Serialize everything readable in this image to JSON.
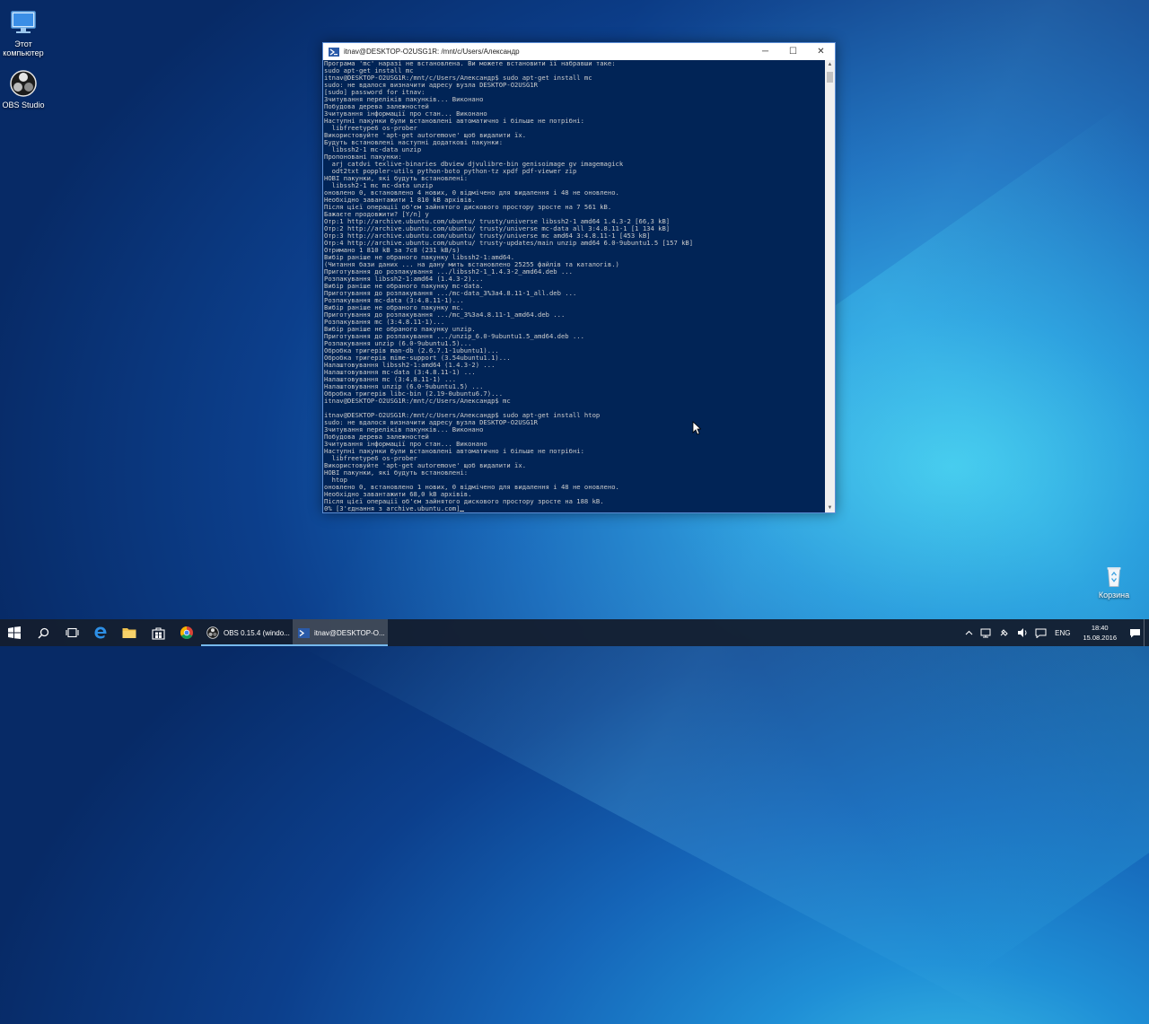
{
  "desktop": {
    "icons": [
      {
        "label": "Этот компьютер",
        "icon": "this-pc-icon"
      },
      {
        "label": "OBS Studio",
        "icon": "obs-icon"
      },
      {
        "label": "Корзина",
        "icon": "recycle-bin-icon"
      }
    ]
  },
  "window": {
    "title": "itnav@DESKTOP-O2USG1R: /mnt/c/Users/Александр",
    "minimize": "─",
    "maximize": "☐",
    "close": "✕",
    "console_lines": [
      "Програма 'mc' наразі не встановлена. Ви можете встановити її набравши таке:",
      "sudo apt-get install mc",
      "itnav@DESKTOP-O2USG1R:/mnt/c/Users/Александр$ sudo apt-get install mc",
      "sudo: не вдалося визначити адресу вузла DESKTOP-O2USG1R",
      "[sudo] password for itnav:",
      "Зчитування переліків пакунків... Виконано",
      "Побудова дерева залежностей",
      "Зчитування інформації про стан... Виконано",
      "Наступні пакунки були встановлені автоматично і більше не потрібні:",
      "  libfreetype6 os-prober",
      "Використовуйте 'apt-get autoremove' щоб видалити їх.",
      "Будуть встановлені наступні додаткові пакунки:",
      "  libssh2-1 mc-data unzip",
      "Пропоновані пакунки:",
      "  arj catdvi texlive-binaries dbview djvulibre-bin genisoimage gv imagemagick",
      "  odt2txt poppler-utils python-boto python-tz xpdf pdf-viewer zip",
      "НОВІ пакунки, які будуть встановлені:",
      "  libssh2-1 mc mc-data unzip",
      "оновлено 0, встановлено 4 нових, 0 відмічено для видалення і 48 не оновлено.",
      "Необхідно завантажити 1 810 kB архівів.",
      "Після цієї операції об'єм зайнятого дискового простору зросте на 7 561 kB.",
      "Бажаєте продовжити? [Y/n] y",
      "Отр:1 http://archive.ubuntu.com/ubuntu/ trusty/universe libssh2-1 amd64 1.4.3-2 [66,3 kB]",
      "Отр:2 http://archive.ubuntu.com/ubuntu/ trusty/universe mc-data all 3:4.8.11-1 [1 134 kB]",
      "Отр:3 http://archive.ubuntu.com/ubuntu/ trusty/universe mc amd64 3:4.8.11-1 [453 kB]",
      "Отр:4 http://archive.ubuntu.com/ubuntu/ trusty-updates/main unzip amd64 6.0-9ubuntu1.5 [157 kB]",
      "Отримано 1 810 kB за 7с8 (231 kB/s)",
      "Вибір раніше не обраного пакунку libssh2-1:amd64.",
      "(Читання бази даних ... на дану мить встановлено 25255 файлів та каталогів.)",
      "Приготування до розпакування .../libssh2-1_1.4.3-2_amd64.deb ...",
      "Розпакування libssh2-1:amd64 (1.4.3-2)...",
      "Вибір раніше не обраного пакунку mc-data.",
      "Приготування до розпакування .../mc-data_3%3a4.8.11-1_all.deb ...",
      "Розпакування mc-data (3:4.8.11-1)...",
      "Вибір раніше не обраного пакунку mc.",
      "Приготування до розпакування .../mc_3%3a4.8.11-1_amd64.deb ...",
      "Розпакування mc (3:4.8.11-1)...",
      "Вибір раніше не обраного пакунку unzip.",
      "Приготування до розпакування .../unzip_6.0-9ubuntu1.5_amd64.deb ...",
      "Розпакування unzip (6.0-9ubuntu1.5)...",
      "Обробка тригерів man-db (2.6.7.1-1ubuntu1)...",
      "Обробка тригерів mime-support (3.54ubuntu1.1)...",
      "Налаштовування libssh2-1:amd64 (1.4.3-2) ...",
      "Налаштовування mc-data (3:4.8.11-1) ...",
      "Налаштовування mc (3:4.8.11-1) ...",
      "Налаштовування unzip (6.0-9ubuntu1.5) ...",
      "Обробка тригерів libc-bin (2.19-0ubuntu6.7)...",
      "itnav@DESKTOP-O2USG1R:/mnt/c/Users/Александр$ mc",
      "",
      "itnav@DESKTOP-O2USG1R:/mnt/c/Users/Александр$ sudo apt-get install htop",
      "sudo: не вдалося визначити адресу вузла DESKTOP-O2USG1R",
      "Зчитування переліків пакунків... Виконано",
      "Побудова дерева залежностей",
      "Зчитування інформації про стан... Виконано",
      "Наступні пакунки були встановлені автоматично і більше не потрібні:",
      "  libfreetype6 os-prober",
      "Використовуйте 'apt-get autoremove' щоб видалити їх.",
      "НОВІ пакунки, які будуть встановлені:",
      "  htop",
      "оновлено 0, встановлено 1 нових, 0 відмічено для видалення і 48 не оновлено.",
      "Необхідно завантажити 68,0 kB архівів.",
      "Після цієї операції об'єм зайнятого дискового простору зросте на 188 kB.",
      "0% [З'єднання з archive.ubuntu.com]"
    ]
  },
  "taskbar": {
    "start_icon": "windows-start-icon",
    "apps": [
      {
        "label": "OBS 0.15.4 (windo...",
        "icon": "obs-icon",
        "active": false
      },
      {
        "label": "itnav@DESKTOP-O...",
        "icon": "terminal-icon",
        "active": true
      }
    ],
    "tray": {
      "language": "ENG",
      "time": "18:40",
      "date": "15.08.2016"
    }
  },
  "colors": {
    "console_bg": "#012456",
    "console_fg": "#cccccc",
    "taskbar_bg": "#141e30",
    "accent": "#76b9ed"
  }
}
